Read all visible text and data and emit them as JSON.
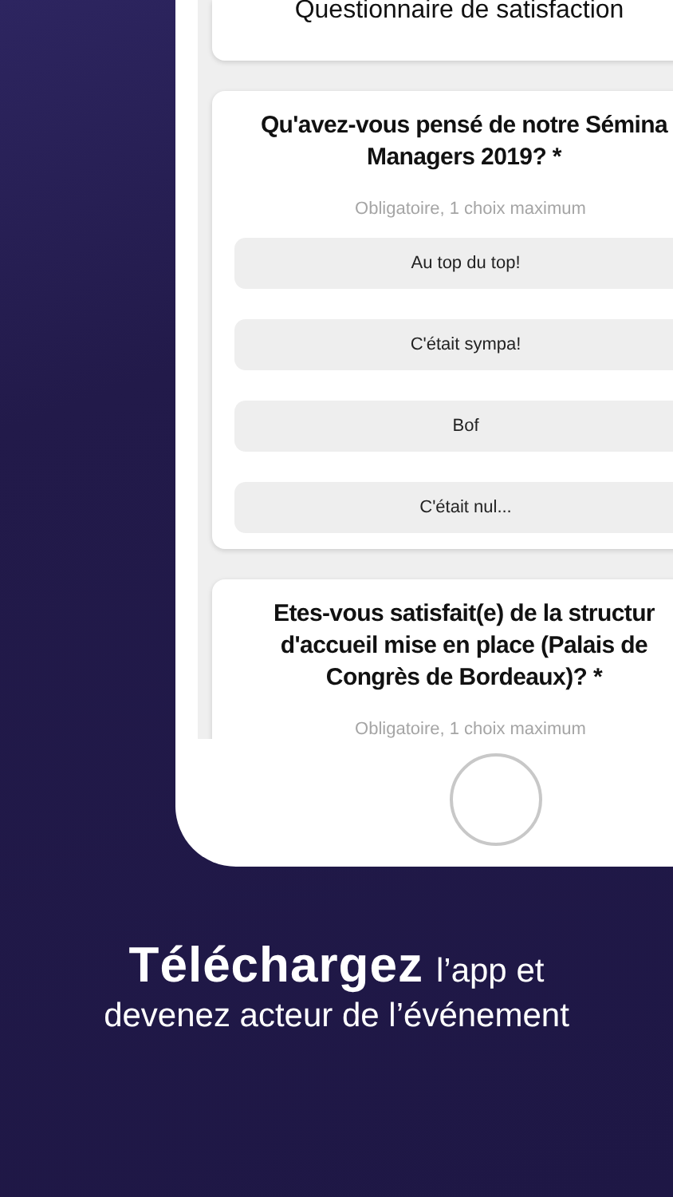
{
  "header_card": {
    "title": "Questionnaire de satisfaction"
  },
  "questions": [
    {
      "lines": [
        "Qu'avez-vous pensé de notre Sémina",
        "Managers 2019? *"
      ],
      "hint": "Obligatoire, 1 choix maximum",
      "options": [
        {
          "label": "Au top du top!",
          "selected": false
        },
        {
          "label": "C'était sympa!",
          "selected": false
        },
        {
          "label": "Bof",
          "selected": false
        },
        {
          "label": "C'était nul...",
          "selected": false
        }
      ]
    },
    {
      "lines": [
        "Etes-vous satisfait(e) de la structur",
        "d'accueil mise en place (Palais de",
        "Congrès de Bordeaux)? *"
      ],
      "hint": "Obligatoire, 1 choix maximum"
    }
  ],
  "caption": {
    "headline": "Téléchargez",
    "rest_line1": "l’app et",
    "line2": "devenez acteur de l’événement"
  }
}
